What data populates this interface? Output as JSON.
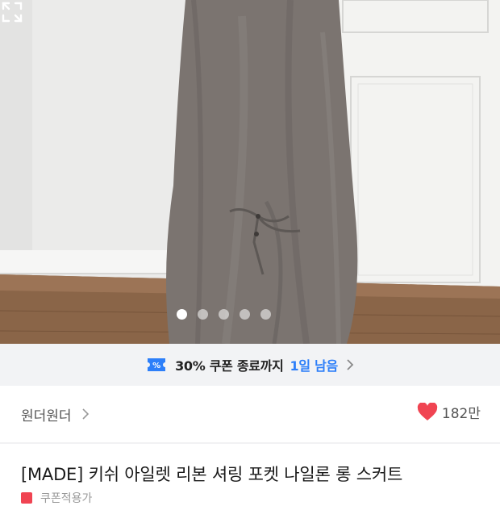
{
  "product_image": {
    "alt": "Khaki eyelet ribbon shirring pocket nylon long skirt",
    "carousel_total": 5,
    "carousel_active_index": 1
  },
  "icons": {
    "expand": "expand-icon",
    "coupon": "ticket-icon",
    "chevron": "chevron-right-icon",
    "like": "heart-icon"
  },
  "coupon_banner": {
    "text": "30% 쿠폰 종료까지",
    "remaining": "1일 남음"
  },
  "seller": {
    "name": "원더원더",
    "like_count": "182만"
  },
  "product": {
    "title": "[MADE] 키쉬 아일렛 리본 셔링 포켓 나일론 롱 스커트",
    "sub_label": "쿠폰적용가"
  },
  "colors": {
    "accent_blue": "#2d7ff9",
    "heart_red": "#f04452",
    "banner_bg": "#f2f3f5"
  }
}
